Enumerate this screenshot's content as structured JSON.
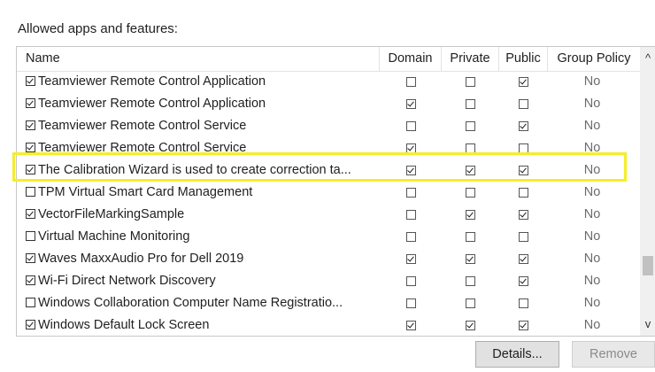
{
  "group_label": "Allowed apps and features:",
  "columns": {
    "name": "Name",
    "domain": "Domain",
    "private": "Private",
    "public": "Public",
    "group_policy": "Group Policy"
  },
  "rows": [
    {
      "name": "Teamviewer Remote Control Application",
      "enabled": true,
      "domain": false,
      "private": false,
      "public": true,
      "group_policy": "No"
    },
    {
      "name": "Teamviewer Remote Control Application",
      "enabled": true,
      "domain": true,
      "private": false,
      "public": false,
      "group_policy": "No"
    },
    {
      "name": "Teamviewer Remote Control Service",
      "enabled": true,
      "domain": false,
      "private": false,
      "public": true,
      "group_policy": "No"
    },
    {
      "name": "Teamviewer Remote Control Service",
      "enabled": true,
      "domain": true,
      "private": false,
      "public": false,
      "group_policy": "No"
    },
    {
      "name": "The Calibration Wizard is used to create correction ta...",
      "enabled": true,
      "domain": true,
      "private": true,
      "public": true,
      "group_policy": "No"
    },
    {
      "name": "TPM Virtual Smart Card Management",
      "enabled": false,
      "domain": false,
      "private": false,
      "public": false,
      "group_policy": "No"
    },
    {
      "name": "VectorFileMarkingSample",
      "enabled": true,
      "domain": false,
      "private": true,
      "public": true,
      "group_policy": "No"
    },
    {
      "name": "Virtual Machine Monitoring",
      "enabled": false,
      "domain": false,
      "private": false,
      "public": false,
      "group_policy": "No"
    },
    {
      "name": "Waves MaxxAudio Pro for Dell 2019",
      "enabled": true,
      "domain": true,
      "private": true,
      "public": true,
      "group_policy": "No"
    },
    {
      "name": "Wi-Fi Direct Network Discovery",
      "enabled": true,
      "domain": false,
      "private": false,
      "public": true,
      "group_policy": "No"
    },
    {
      "name": "Windows Collaboration Computer Name Registratio...",
      "enabled": false,
      "domain": false,
      "private": false,
      "public": false,
      "group_policy": "No"
    },
    {
      "name": "Windows Default Lock Screen",
      "enabled": true,
      "domain": true,
      "private": true,
      "public": true,
      "group_policy": "No"
    }
  ],
  "scrollbar": {
    "up_glyph": "^",
    "down_glyph": "v"
  },
  "buttons": {
    "details": "Details...",
    "remove": "Remove"
  },
  "highlight_color": "#f4ee2a"
}
